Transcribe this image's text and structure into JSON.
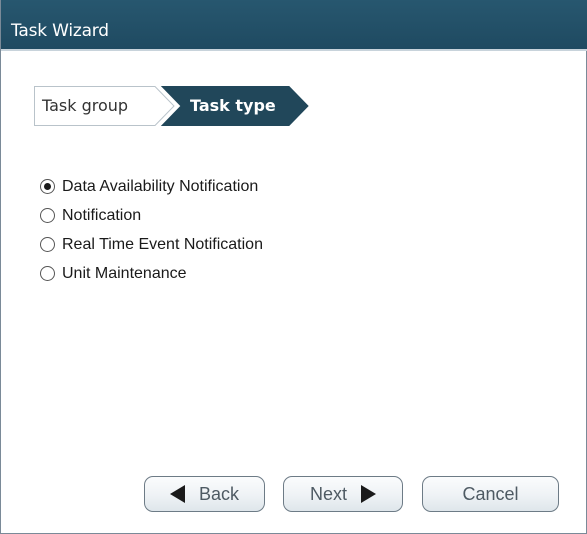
{
  "window": {
    "title": "Task Wizard"
  },
  "steps": [
    {
      "label": "Task group",
      "active": false
    },
    {
      "label": "Task type",
      "active": true
    }
  ],
  "task_types": {
    "selected": "Data Availability Notification",
    "options": [
      {
        "label": "Data Availability Notification",
        "checked": true
      },
      {
        "label": "Notification",
        "checked": false
      },
      {
        "label": "Real Time Event Notification",
        "checked": false
      },
      {
        "label": "Unit Maintenance",
        "checked": false
      }
    ]
  },
  "buttons": {
    "back_label": "Back",
    "next_label": "Next",
    "cancel_label": "Cancel"
  },
  "colors": {
    "titlebar": "#1f4a61",
    "active_step": "#21475a",
    "inactive_step_border": "#b9c3ca",
    "button_border": "#6d7b86"
  }
}
